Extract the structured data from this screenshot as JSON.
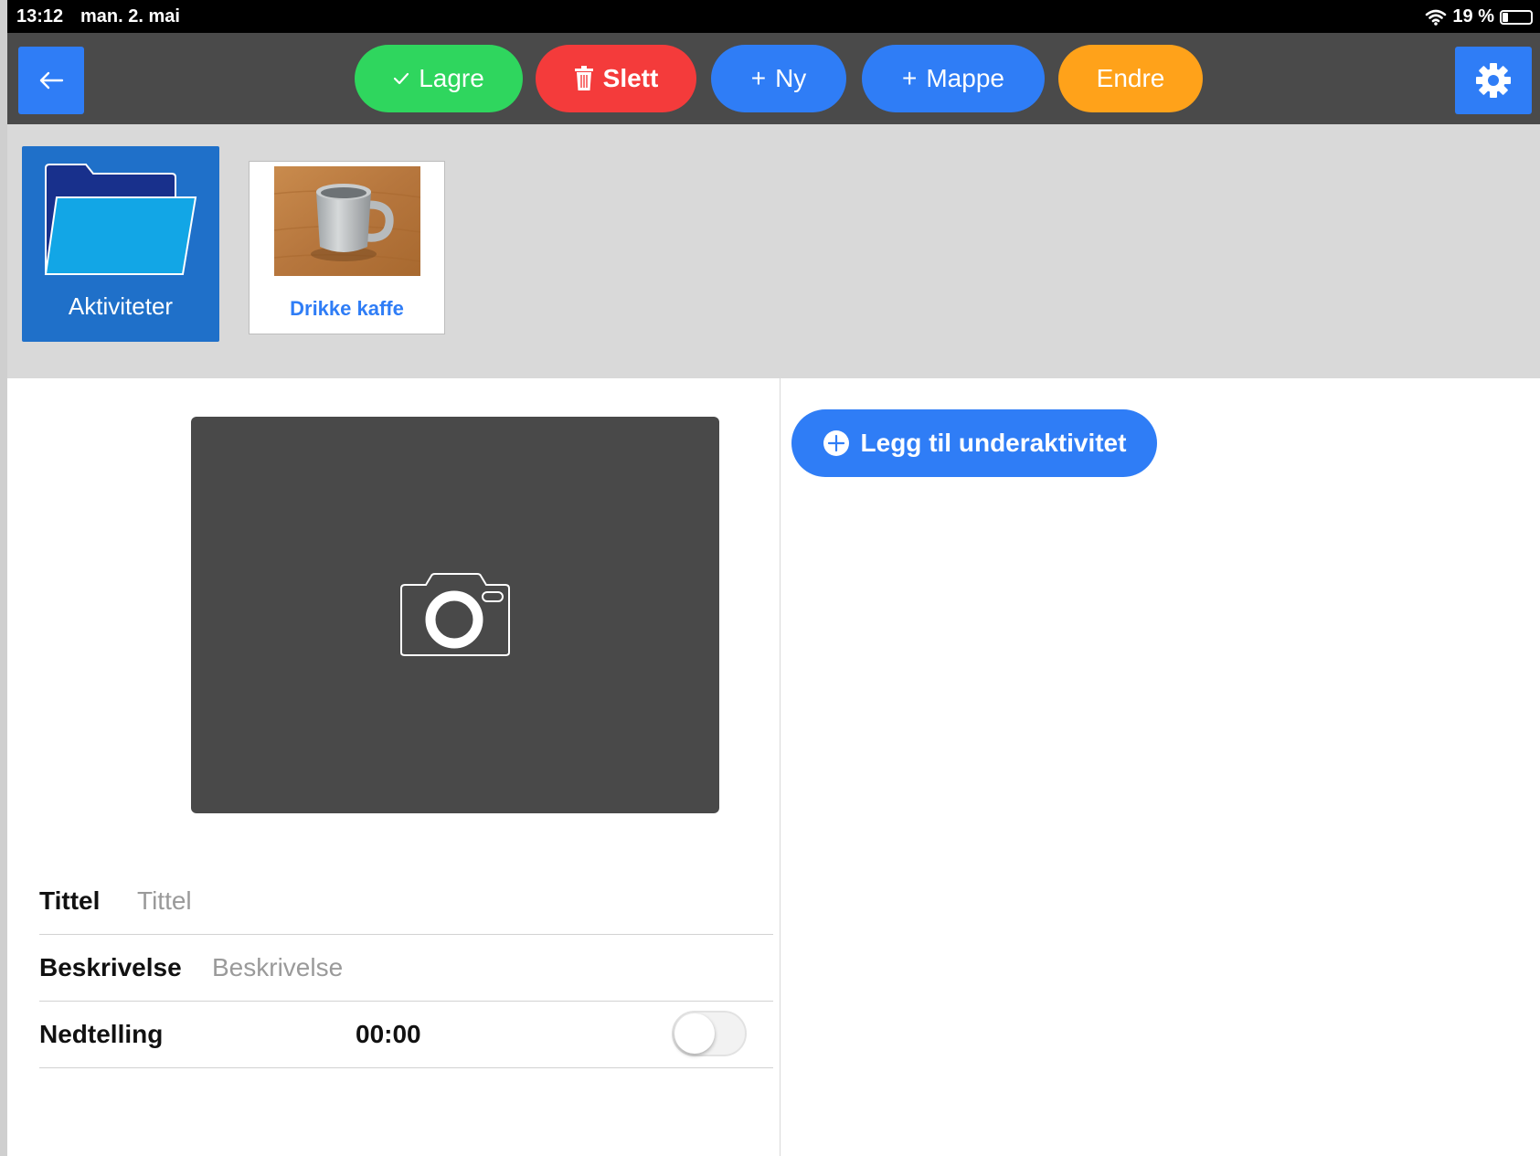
{
  "status_bar": {
    "time": "13:12",
    "date": "man. 2. mai",
    "battery": "19 %",
    "icons": [
      "wifi-icon",
      "battery-icon"
    ]
  },
  "toolbar": {
    "back_icon": "arrow-left-icon",
    "lagre_label": "Lagre",
    "slett_label": "Slett",
    "ny_label": "Ny",
    "mappe_label": "Mappe",
    "endre_label": "Endre",
    "settings_icon": "gear-icon"
  },
  "colors": {
    "green": "#2fd65e",
    "red": "#f43b3b",
    "blue": "#2f7df6",
    "orange": "#ffa21a",
    "toolbar": "#4a4a4a",
    "folder_tile": "#1f70c9"
  },
  "tiles": {
    "folder_label": "Aktiviteter",
    "item_label": "Drikke kaffe"
  },
  "form": {
    "title_label": "Tittel",
    "title_placeholder": "Tittel",
    "title_value": "",
    "desc_label": "Beskrivelse",
    "desc_placeholder": "Beskrivelse",
    "desc_value": "",
    "countdown_label": "Nedtelling",
    "countdown_value": "00:00",
    "countdown_enabled": false
  },
  "right_panel": {
    "add_subactivity_label": "Legg til underaktivitet"
  }
}
